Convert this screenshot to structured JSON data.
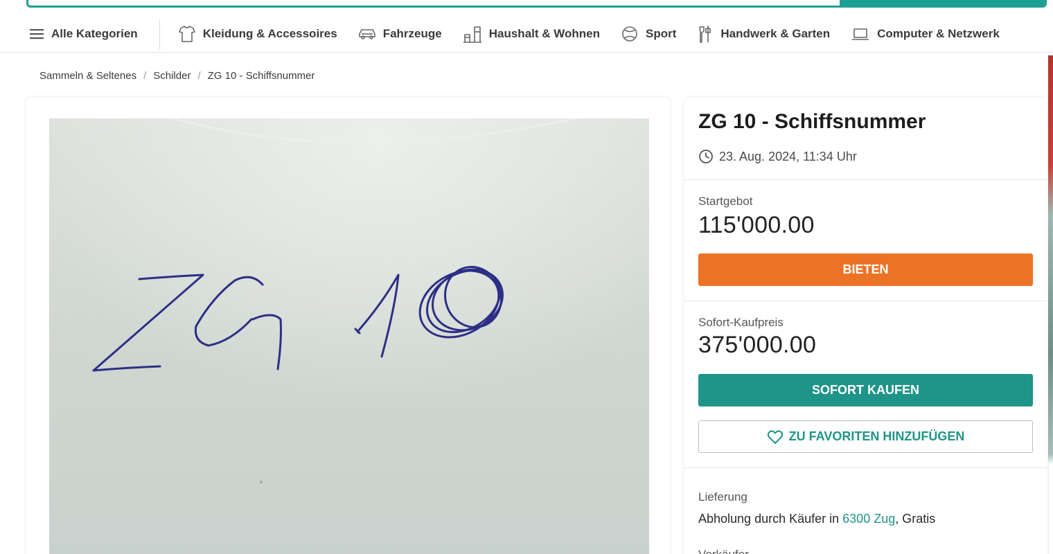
{
  "nav": {
    "all_categories": "Alle Kategorien",
    "categories": [
      {
        "label": "Kleidung & Accessoires",
        "icon": "shirt-icon"
      },
      {
        "label": "Fahrzeuge",
        "icon": "car-icon"
      },
      {
        "label": "Haushalt & Wohnen",
        "icon": "household-icon"
      },
      {
        "label": "Sport",
        "icon": "ball-icon"
      },
      {
        "label": "Handwerk & Garten",
        "icon": "tools-icon"
      },
      {
        "label": "Computer & Netzwerk",
        "icon": "laptop-icon"
      }
    ]
  },
  "breadcrumb": [
    "Sammeln & Seltenes",
    "Schilder",
    "ZG 10 - Schiffsnummer"
  ],
  "listing": {
    "title": "ZG 10 - Schiffsnummer",
    "datetime": "23. Aug. 2024, 11:34 Uhr",
    "start_bid_label": "Startgebot",
    "start_bid": "115'000.00",
    "bid_button": "BIETEN",
    "buy_now_label": "Sofort-Kaufpreis",
    "buy_now_price": "375'000.00",
    "buy_now_button": "SOFORT KAUFEN",
    "favorite_button": "ZU FAVORITEN HINZUFÜGEN",
    "delivery_label": "Lieferung",
    "delivery_prefix": "Abholung durch Käufer in ",
    "delivery_location": "6300 Zug",
    "delivery_suffix": ", Gratis",
    "seller_label": "Verkäufer"
  },
  "colors": {
    "accent_teal": "#1f9488",
    "bid_orange": "#ec7325"
  }
}
